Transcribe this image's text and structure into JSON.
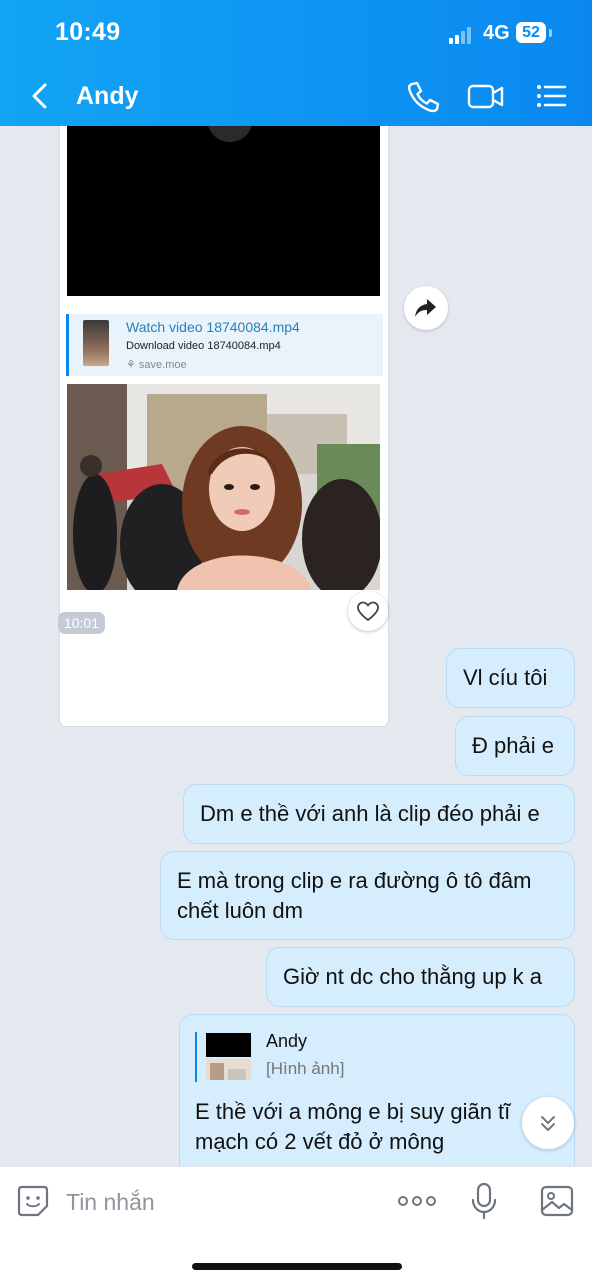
{
  "status_bar": {
    "time": "10:49",
    "network": "4G",
    "battery": "52"
  },
  "header": {
    "contact_name": "Andy"
  },
  "video_message": {
    "link_title": "Watch video 18740084.mp4",
    "link_subtitle": "Download video 18740084.mp4",
    "link_domain": "save.moe",
    "sent_time": "10:01"
  },
  "messages": [
    "Vl cíu tôi",
    "Đ phải e",
    "Dm e thề với anh là clip đéo phải e",
    "E mà trong clip e ra đường ô tô đâm chết luôn dm",
    "Giờ nt dc cho thằng up k a"
  ],
  "reply_message": {
    "quoted_name": "Andy",
    "quoted_type": "[Hình ảnh]",
    "text": "E thề với a mông e bị suy giãn tĩ mạch có 2 vết đỏ ở mông"
  },
  "composer": {
    "placeholder": "Tin nhắn"
  },
  "colors": {
    "accent": "#0a88f0",
    "bubble_outgoing": "#d5edfd",
    "background": "#e4e8ef"
  }
}
